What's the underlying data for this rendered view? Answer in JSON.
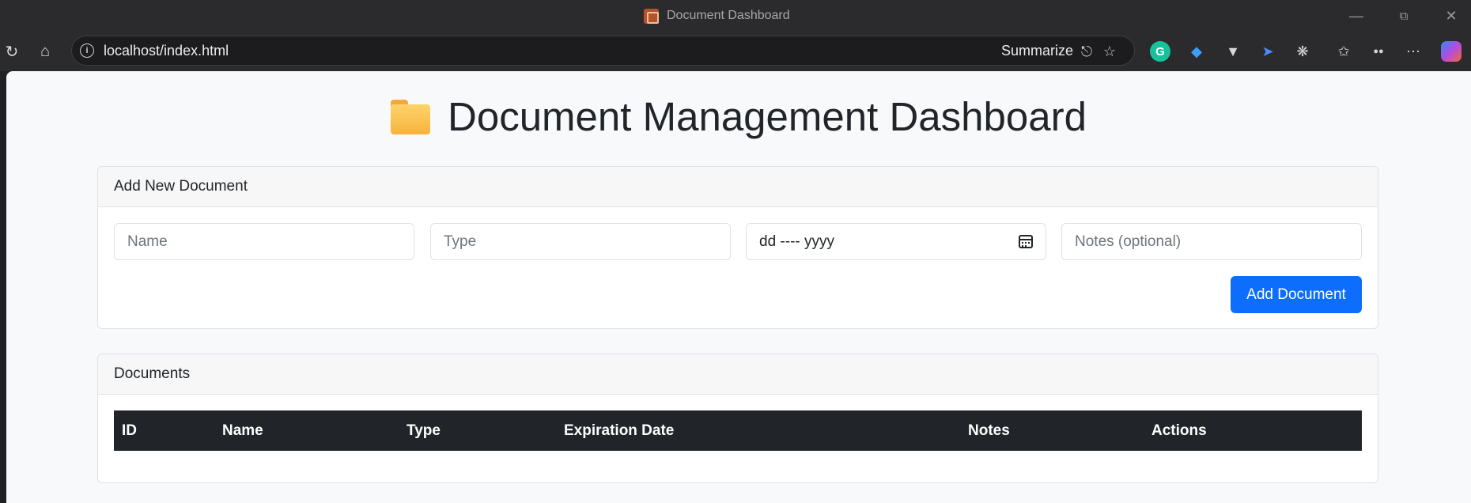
{
  "window": {
    "title": "Document Dashboard"
  },
  "browser": {
    "url": "localhost/index.html",
    "summarize_label": "Summarize",
    "grammarly_label": "G"
  },
  "page": {
    "heading": "Document Management Dashboard",
    "heading_icon": "folder-icon",
    "add_card": {
      "header": "Add New Document",
      "name_placeholder": "Name",
      "type_placeholder": "Type",
      "date_value": "dd ---- yyyy",
      "notes_placeholder": "Notes (optional)",
      "add_button": "Add Document"
    },
    "documents_card": {
      "header": "Documents",
      "columns": [
        "ID",
        "Name",
        "Type",
        "Expiration Date",
        "Notes",
        "Actions"
      ],
      "rows": []
    }
  },
  "colors": {
    "primary": "#0d6efd",
    "table_header": "#212529",
    "page_bg": "#f8f9fa",
    "chrome_bg": "#2b2b2e"
  }
}
